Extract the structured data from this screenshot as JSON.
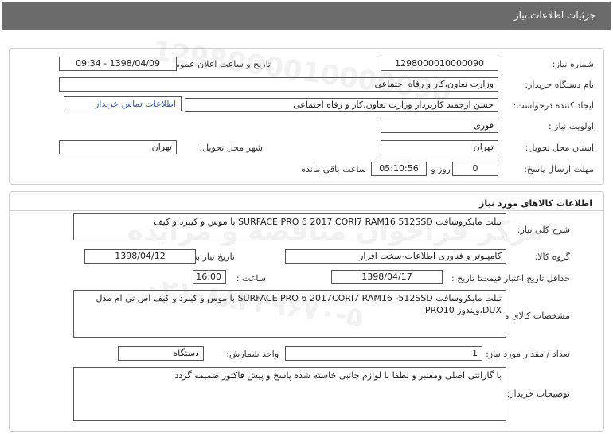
{
  "header": {
    "title": "جزئیات اطلاعات نیاز"
  },
  "need": {
    "number_label": "شماره نیاز:",
    "number": "1298000010000090",
    "announce_label": "تاریخ و ساعت اعلان عمومی:",
    "announce": "1398/04/09 - 09:34",
    "buyer_label": "نام دستگاه خریدار:",
    "buyer": "وزارت تعاون،کار و رفاه اجتماعی",
    "creator_label": "ایجاد کننده درخواست:",
    "creator": "حسن ارجمند کارپرداز وزارت تعاون،کار و رفاه اجتماعی",
    "contact_link": "اطلاعات تماس خریدار",
    "priority_label": "اولویت نیاز :",
    "priority": "فوری",
    "province_label": "استان محل تحویل:",
    "province": "تهران",
    "city_label": "شهر محل تحویل:",
    "city": "تهران",
    "deadline_label": "مهلت ارسال پاسخ:",
    "days": "0",
    "days_suffix": "روز و",
    "time_left": "05:10:56",
    "time_suffix": "ساعت باقی مانده"
  },
  "goods": {
    "section_title": "اطلاعات کالاهای مورد نیاز",
    "summary_label": "شرح کلی نیاز:",
    "summary": "تبلت مایکروسافت SURFACE PRO 6 2017 CORI7 RAM16 512SSD با موس و کیبرد و کیف",
    "group_label": "گروه کالا:",
    "group": "کامپیوتر و فناوری اطلاعات-سخت افزار",
    "need_date_label": "تاریخ نیاز به کالا:",
    "need_date": "1398/04/12",
    "validity_label": "حداقل تاریخ اعتبار قیمت:",
    "until_label": "تا تاریخ :",
    "until_date": "1398/04/17",
    "hour_label": "ساعت :",
    "hour": "16:00",
    "specs_label": "مشخصات کالای مورد نیاز:",
    "specs": "تبلت مایکروسافت SURFACE PRO 6 2017CORI7 RAM16 -512SSD با موس و کیبرد و کیف اس تی ام مدل DUX،ویندوز PRO10",
    "qty_label": "تعداد / مقدار مورد نیاز:",
    "qty": "1",
    "unit_label": "واحد شمارش:",
    "unit": "دستگاه",
    "notes_label": "توضیحات خریدار:",
    "notes": "با گارانتی اصلی ومعتبر و لطفا با لوازم جانبی خاسته شده پاسخ و پیش فاکتور ضمیمه گردد"
  },
  "watermark": {
    "line1": "1298000010000090",
    "line2": "مرکز فراخوان مناقصه و مزایده",
    "line3": "۰۲۱-۸۸۳۴۹۶۷۰-۵"
  }
}
